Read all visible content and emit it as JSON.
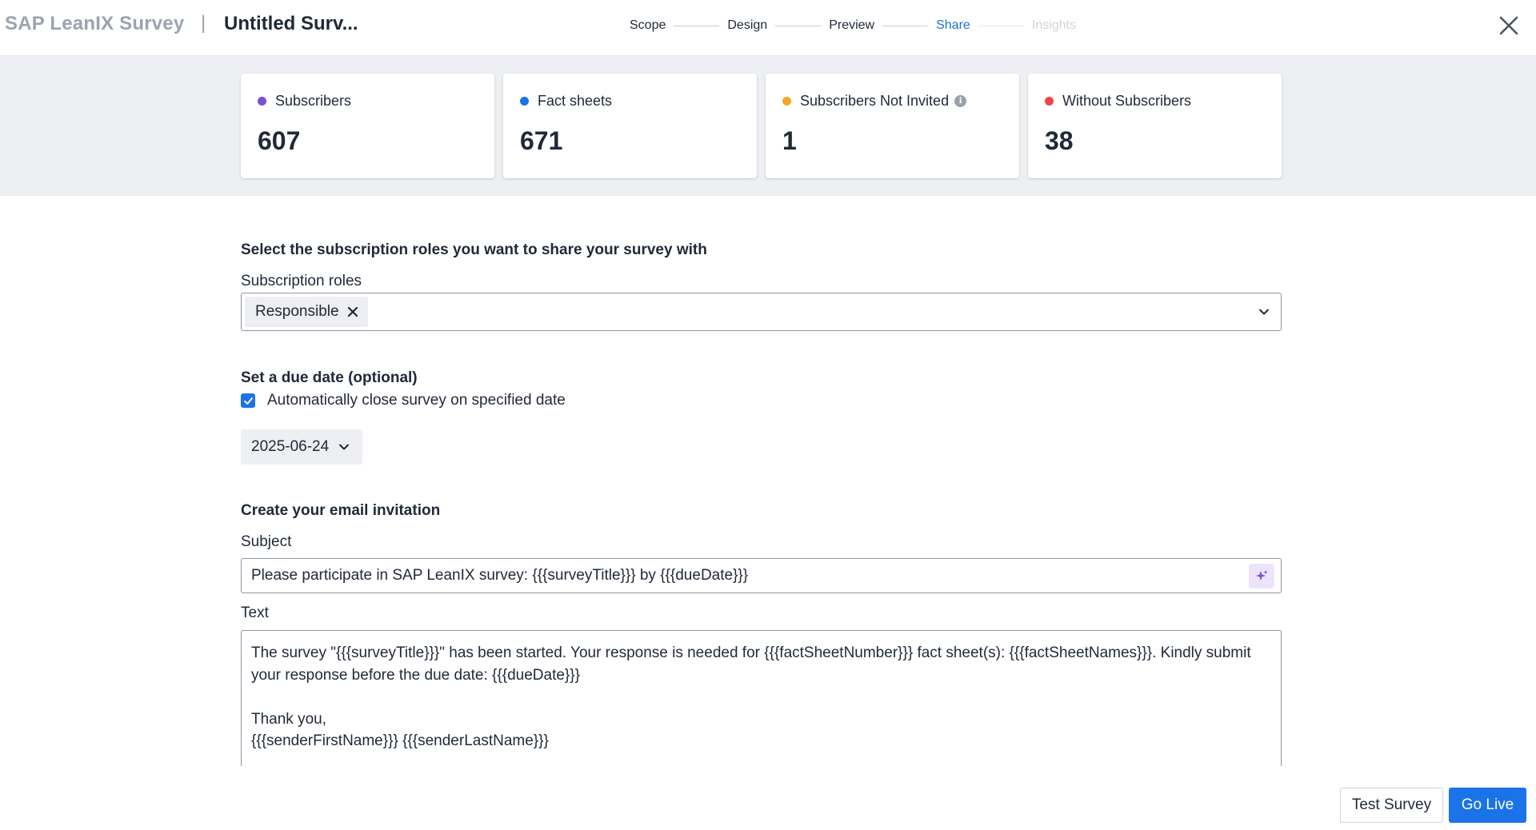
{
  "header": {
    "brand": "SAP LeanIX Survey",
    "separator": "|",
    "survey_title": "Untitled Surv...",
    "close_icon": "close-icon"
  },
  "stepper": {
    "steps": [
      {
        "label": "Scope",
        "state": "done"
      },
      {
        "label": "Design",
        "state": "done"
      },
      {
        "label": "Preview",
        "state": "done"
      },
      {
        "label": "Share",
        "state": "active"
      },
      {
        "label": "Insights",
        "state": "disabled"
      }
    ]
  },
  "stats": [
    {
      "label": "Subscribers",
      "value": "607",
      "color": "#7b4fd6",
      "info": false
    },
    {
      "label": "Fact sheets",
      "value": "671",
      "color": "#1a73e8",
      "info": false
    },
    {
      "label": "Subscribers Not Invited",
      "value": "1",
      "color": "#f5a623",
      "info": true
    },
    {
      "label": "Without Subscribers",
      "value": "38",
      "color": "#ef4444",
      "info": false
    }
  ],
  "roles_section": {
    "title": "Select the subscription roles you want to share your survey with",
    "label": "Subscription roles",
    "selected": "Responsible"
  },
  "due_date_section": {
    "title": "Set a due date (optional)",
    "checkbox_label": "Automatically close survey on specified date",
    "checked": true,
    "date_value": "2025-06-24"
  },
  "email_section": {
    "title": "Create your email invitation",
    "subject_label": "Subject",
    "subject_value": "Please participate in SAP LeanIX survey: {{{surveyTitle}}} by {{{dueDate}}}",
    "text_label": "Text",
    "text_lines": [
      "The survey \"{{{surveyTitle}}}\" has been started. Your response is needed for {{{factSheetNumber}}} fact sheet(s): {{{factSheetNames}}}. Kindly submit",
      "your response before the due date: {{{dueDate}}}",
      "",
      "Thank you,",
      "{{{senderFirstName}}} {{{senderLastName}}}"
    ]
  },
  "footer": {
    "test_label": "Test Survey",
    "live_label": "Go Live"
  },
  "colors": {
    "accent": "#1a73e8",
    "active_step": "#1a73d9",
    "band_bg": "#edeff2"
  }
}
